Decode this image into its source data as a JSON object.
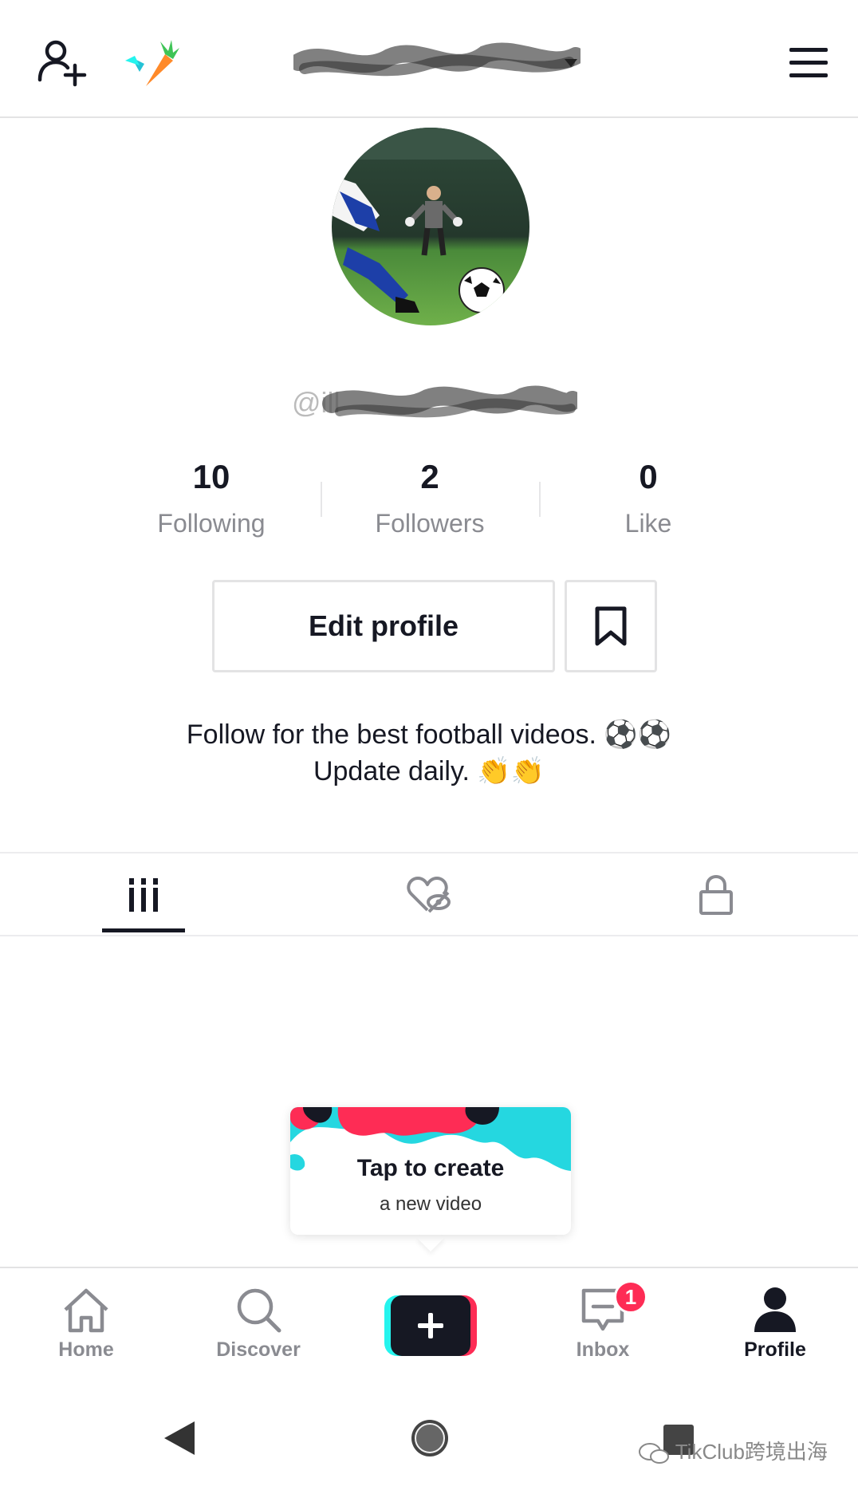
{
  "stats": {
    "following": {
      "count": "10",
      "label": "Following"
    },
    "followers": {
      "count": "2",
      "label": "Followers"
    },
    "likes": {
      "count": "0",
      "label": "Like"
    }
  },
  "handle_visible": "@ill",
  "buttons": {
    "edit_profile": "Edit profile"
  },
  "bio": {
    "line1": "Follow for the best football videos. ⚽⚽",
    "line2": "Update daily. 👏👏"
  },
  "create_tip": {
    "title": "Tap to create",
    "subtitle": "a new video"
  },
  "bottom_nav": {
    "home": "Home",
    "discover": "Discover",
    "inbox": "Inbox",
    "inbox_badge": "1",
    "profile": "Profile"
  },
  "watermark": "TikClub跨境出海",
  "colors": {
    "accent_red": "#fe2c55",
    "accent_cyan": "#25f4ee",
    "text_dark": "#161823",
    "text_gray": "#8a8b91"
  },
  "icons": [
    "add-user-icon",
    "carrot-icon",
    "menu-icon",
    "bookmark-icon",
    "grid-icon",
    "liked-hidden-icon",
    "lock-icon",
    "home-icon",
    "search-icon",
    "plus-icon",
    "inbox-icon",
    "profile-icon",
    "back-icon",
    "home-circle-icon",
    "recents-icon",
    "wechat-icon"
  ]
}
